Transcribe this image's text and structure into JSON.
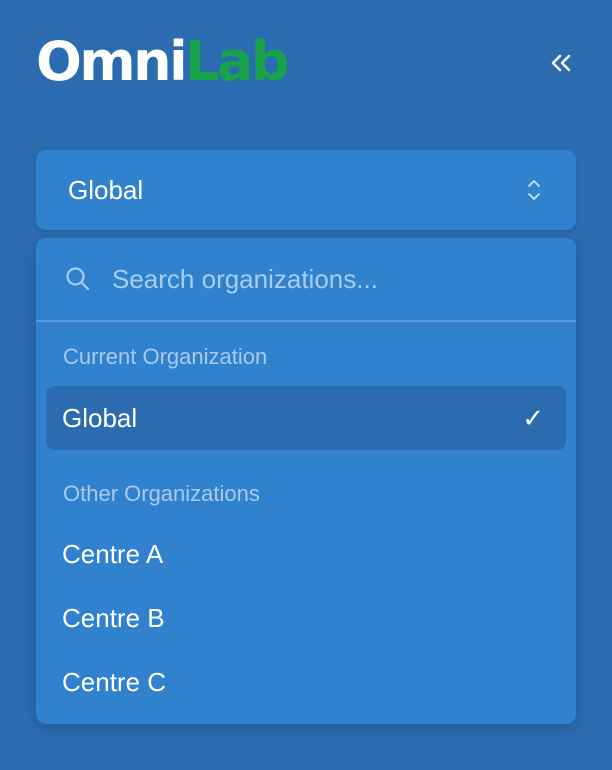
{
  "brand": {
    "part1": "Omni",
    "part2": "Lab",
    "part2_color": "#16a34a"
  },
  "collapse_icon": "double-chevron-left-icon",
  "org_select": {
    "value": "Global",
    "icon": "chevron-up-down-icon"
  },
  "dropdown": {
    "search": {
      "placeholder": "Search organizations...",
      "value": "",
      "icon": "search-icon"
    },
    "current_label": "Current Organization",
    "current_item": {
      "label": "Global",
      "selected": true,
      "icon": "check-icon",
      "check": "✓"
    },
    "other_label": "Other Organizations",
    "other_items": [
      {
        "label": "Centre A"
      },
      {
        "label": "Centre B"
      },
      {
        "label": "Centre C"
      }
    ]
  },
  "colors": {
    "background": "#2b6cb0",
    "panel": "#3182ce",
    "selected_row": "#2b6cb0",
    "muted_text": "#a9c9ec"
  }
}
